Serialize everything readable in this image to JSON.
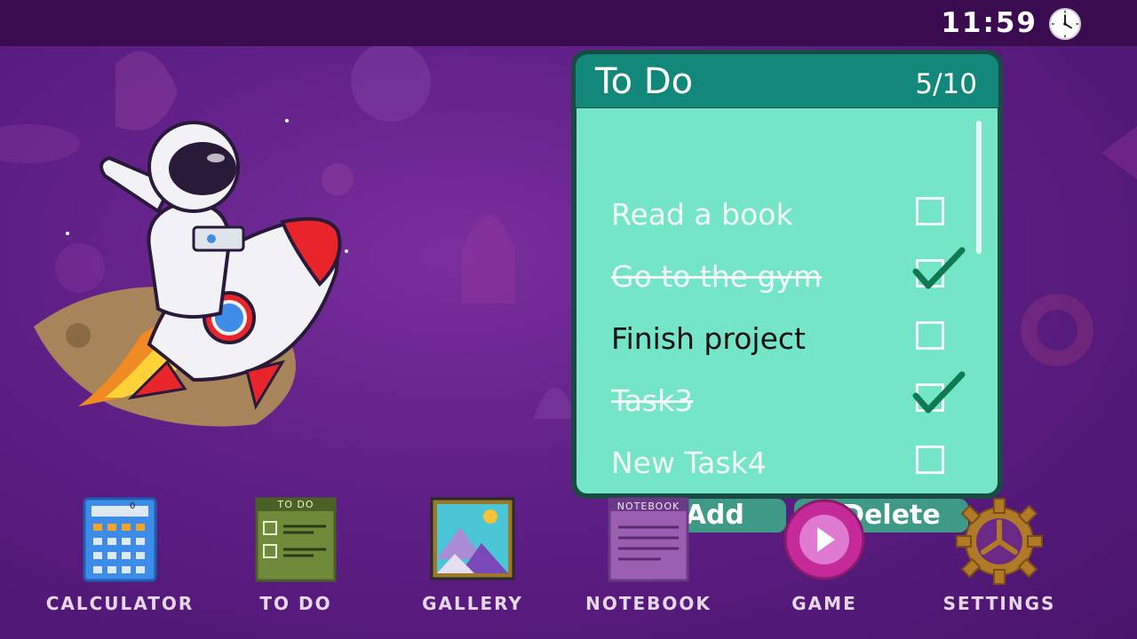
{
  "status_bar": {
    "time": "11:59",
    "clock_icon": "clock-icon"
  },
  "todo": {
    "title": "To Do",
    "count": "5/10",
    "tasks": [
      {
        "label": "Read a book",
        "done": false,
        "style": "muted"
      },
      {
        "label": "Go to the gym",
        "done": true,
        "style": "strikethrough"
      },
      {
        "label": "Finish project",
        "done": false,
        "style": "active"
      },
      {
        "label": "Task3",
        "done": true,
        "style": "strikethrough"
      },
      {
        "label": "New Task4",
        "done": false,
        "style": "muted"
      }
    ],
    "add_label": "+ Add",
    "delete_label": "- Delete"
  },
  "apps": [
    {
      "label": "CALCULATOR",
      "icon": "calculator-icon",
      "display_value": "0"
    },
    {
      "label": "TO DO",
      "icon": "todo-list-icon",
      "header": "TO DO"
    },
    {
      "label": "GALLERY",
      "icon": "gallery-icon"
    },
    {
      "label": "NOTEBOOK",
      "icon": "notebook-icon",
      "header": "NOTEBOOK"
    },
    {
      "label": "GAME",
      "icon": "play-icon"
    },
    {
      "label": "SETTINGS",
      "icon": "gear-icon"
    }
  ],
  "colors": {
    "background": "#5e1f86",
    "topbar": "#3b0b50",
    "todo_header": "#12887a",
    "todo_body": "#74e5c6",
    "button": "#3e9a86",
    "checkmark": "#0f7a52"
  }
}
